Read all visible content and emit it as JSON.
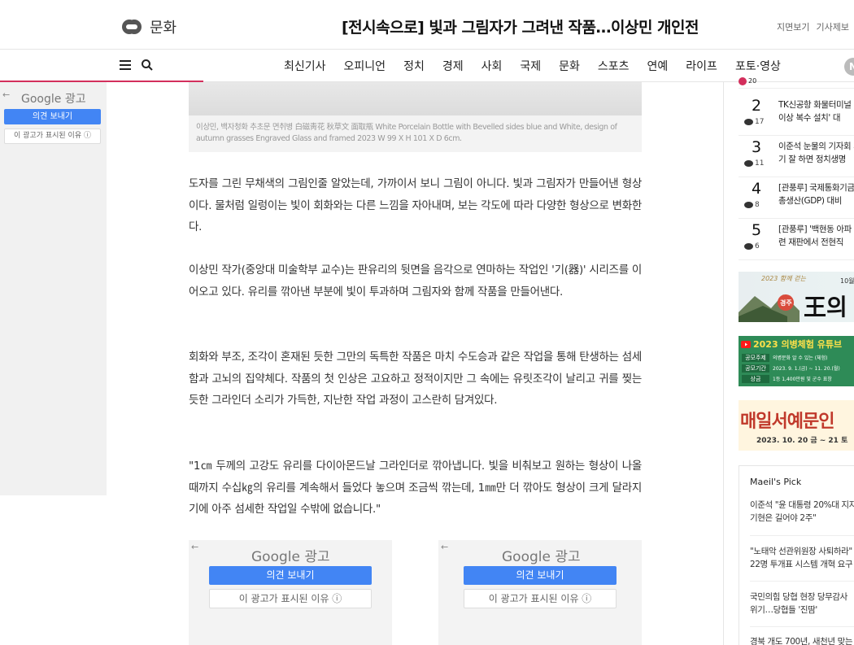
{
  "header": {
    "section_name": "문화",
    "headline": "[전시속으로] 빛과 그림자가 그려낸 작품…이상민 개인전",
    "links": [
      "지면보기",
      "기사제보"
    ]
  },
  "nav": {
    "items": [
      "최신기사",
      "오피니언",
      "정치",
      "경제",
      "사회",
      "국제",
      "문화",
      "스포츠",
      "연예",
      "라이프",
      "포토·영상"
    ],
    "badge": "N"
  },
  "ads": {
    "google_label": "Google 광고",
    "feedback_label": "의견 보내기",
    "why_label": "이 광고가 표시된 이유 ⓘ"
  },
  "article": {
    "caption": "이상민, 백자청화 추초문 면취병 白磁靑花 秋草文 面取甁 White Porcelain Bottle with Bevelled sides blue and White, design of autumn grasses Engraved Glass and framed 2023 W 99 X H 101 X D 6cm.",
    "paragraphs": [
      "도자를 그린 무채색의 그림인줄 알았는데, 가까이서 보니 그림이 아니다. 빛과 그림자가 만들어낸 형상이다. 물처럼 일렁이는 빛이 회화와는 다른 느낌을 자아내며, 보는 각도에 따라 다양한 형상으로 변화한다.",
      "이상민 작가(중앙대 미술학부 교수)는 판유리의 뒷면을 음각으로 연마하는 작업인 '기(器)' 시리즈를 이어오고 있다. 유리를 깎아낸 부분에 빛이 투과하며 그림자와 함께 작품을 만들어낸다.",
      "회화와 부조, 조각이 혼재된 듯한 그만의 독특한 작품은 마치 수도승과 같은 작업을 통해 탄생하는 섬세함과 고뇌의 집약체다. 작품의 첫 인상은 고요하고 정적이지만 그 속에는 유릿조각이 날리고 귀를 찢는 듯한 그라인더 소리가 가득한, 지난한 작업 과정이 고스란히 담겨있다.",
      "\"1㎝ 두께의 고강도 유리를 다이아몬드날 그라인더로 깎아냅니다. 빛을 비춰보고 원하는 형상이 나올 때까지 수십㎏의 유리를 계속해서 들었다 놓으며 조금씩 깎는데, 1㎜만 더 깎아도 형상이 크게 달라지기에 아주 섬세한 작업일 수밖에 없습니다.\""
    ]
  },
  "ranking": {
    "top_count": "20",
    "items": [
      {
        "num": "2",
        "comments": "17",
        "text": "TK신공항 화물터미널 개 이상 복수 설치' 대"
      },
      {
        "num": "3",
        "comments": "11",
        "text": "이준석 눈물의 기자회 서기 잘 하면 정치생명"
      },
      {
        "num": "4",
        "comments": "8",
        "text": "[관풍루] 국제통화기금 내총생산(GDP) 대비 "
      },
      {
        "num": "5",
        "comments": "6",
        "text": "[관풍루] '백현동 아파 관련 재판에서 전현직"
      }
    ]
  },
  "banners": {
    "b1_top": "2023 함께 걷는",
    "b1_city": "경주",
    "b1_big": "王의",
    "b1_small": "10월",
    "b2_title": "2023 의병체험 유튜브",
    "b2_rows": [
      {
        "label": "공모주제",
        "text": "의병문화 알 수 있는 (체험)"
      },
      {
        "label": "공모기간",
        "text": "2023. 9. 1.(금) ~ 11. 20.(월)"
      },
      {
        "label": "상금",
        "text": "1등 1,400만원 및 군수 표창"
      }
    ],
    "b3_title": "매일서예문인",
    "b3_date": "2023. 10. 20 금 ~ 21 토"
  },
  "pick": {
    "title": "Maeil's Pick",
    "items": [
      [
        "이준석 \"윤 대통령 20%대 지지",
        "기현은 길어야 2주\""
      ],
      [
        "\"노태악 선관위원장 사퇴하라\"",
        "22명 투개표 시스템 개혁 요구"
      ],
      [
        "국민의힘 당협 현장 당무감사 ",
        "위기…당협들 '진땀'"
      ],
      [
        "경북 개도 700년, 새천년 맞는"
      ]
    ]
  }
}
